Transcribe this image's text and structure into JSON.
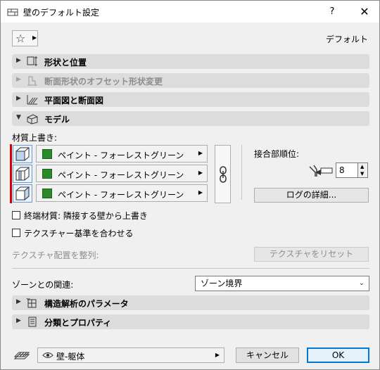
{
  "window": {
    "title": "壁のデフォルト設定",
    "help_label": "?",
    "close_label": "✕"
  },
  "toolbar": {
    "favorites_icon": "star-icon",
    "default_label": "デフォルト"
  },
  "sections": {
    "shape_position": "形状と位置",
    "section_offset": "断面形状のオフセット形状変更",
    "plan_section": "平面図と断面図",
    "model": "モデル",
    "structural": "構造解析のパラメータ",
    "classification": "分類とプロパティ"
  },
  "model": {
    "material_override_label": "材質上書き:",
    "materials": [
      {
        "label": "ペイント - フォーレストグリーン",
        "color": "#2a8a2a"
      },
      {
        "label": "ペイント - フォーレストグリーン",
        "color": "#2a8a2a"
      },
      {
        "label": "ペイント - フォーレストグリーン",
        "color": "#2a8a2a"
      }
    ],
    "join_order_label": "接合部順位:",
    "join_order_value": "8",
    "log_button": "ログの詳細...",
    "end_material_label": "終端材質: 隣接する壁から上書き",
    "texture_align_label": "テクスチャー基準を合わせる",
    "texture_position_label": "テクスチャ配置を整列:",
    "reset_texture_button": "テクスチャをリセット",
    "end_material_checked": false,
    "texture_align_checked": false
  },
  "zone": {
    "label": "ゾーンとの関連:",
    "selected": "ゾーン境界"
  },
  "footer": {
    "layer_label": "壁-躯体",
    "cancel_label": "キャンセル",
    "ok_label": "OK"
  },
  "colors": {
    "accent": "#0078d7",
    "red_marker": "#d40000",
    "section_bg": "#dcdcdc",
    "material_swatch": "#2a8a2a"
  }
}
